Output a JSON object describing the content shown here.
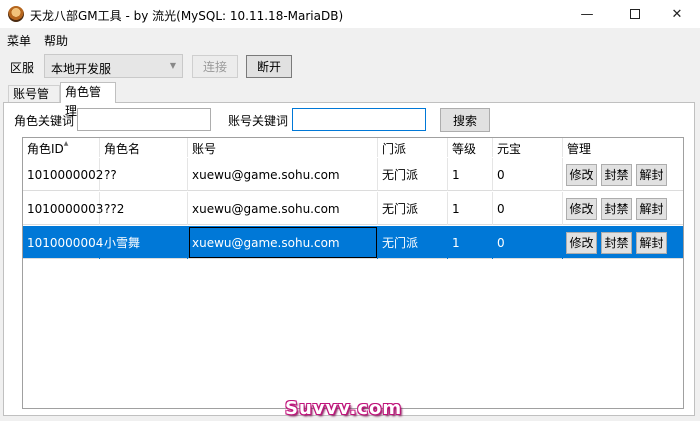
{
  "window": {
    "title": "天龙八部GM工具 - by 流光(MySQL: 10.11.18-MariaDB)",
    "minimize": "—",
    "close": "✕"
  },
  "menu": {
    "items": [
      "菜单",
      "帮助"
    ]
  },
  "server": {
    "label": "区服",
    "selected": "本地开发服",
    "connect_label": "连接",
    "disconnect_label": "断开"
  },
  "tabs": [
    {
      "label": "账号管理",
      "active": false
    },
    {
      "label": "角色管理",
      "active": true
    }
  ],
  "search": {
    "role_keyword_label": "角色关键词",
    "role_keyword_value": "",
    "account_keyword_label": "账号关键词",
    "account_keyword_value": "",
    "search_label": "搜索"
  },
  "table": {
    "columns": [
      "角色ID",
      "角色名",
      "账号",
      "门派",
      "等级",
      "元宝",
      "管理"
    ],
    "actions": {
      "edit": "修改",
      "ban": "封禁",
      "unban": "解封"
    },
    "rows": [
      {
        "id": "1010000002",
        "name": "??",
        "account": "xuewu@game.sohu.com",
        "sect": "无门派",
        "level": "1",
        "yuanbao": "0",
        "selected": false
      },
      {
        "id": "1010000003",
        "name": "??2",
        "account": "xuewu@game.sohu.com",
        "sect": "无门派",
        "level": "1",
        "yuanbao": "0",
        "selected": false
      },
      {
        "id": "1010000004",
        "name": "小雪舞",
        "account": "xuewu@game.sohu.com",
        "sect": "无门派",
        "level": "1",
        "yuanbao": "0",
        "selected": true
      }
    ]
  },
  "watermark": "Suvvv.com",
  "colors": {
    "selection": "#0078d7",
    "watermark_outline": "#c0137b"
  }
}
